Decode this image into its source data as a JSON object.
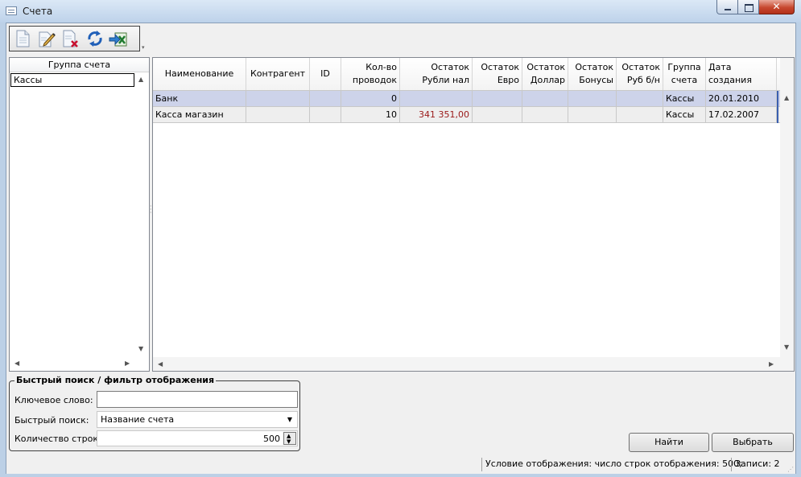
{
  "window": {
    "title": "Счета"
  },
  "toolbar": {
    "buttons": [
      {
        "name": "new-document-icon"
      },
      {
        "name": "edit-pencil-icon"
      },
      {
        "name": "delete-document-icon"
      },
      {
        "name": "refresh-icon"
      },
      {
        "name": "export-excel-icon"
      }
    ]
  },
  "groups": {
    "header": "Группа счета",
    "items": [
      "Кассы"
    ]
  },
  "grid": {
    "columns": [
      "Наименование",
      "Контрагент",
      "ID",
      "Кол-во проводок",
      "Остаток Рубли нал",
      "Остаток Евро",
      "Остаток Доллар",
      "Остаток Бонусы",
      "Остаток Руб б/н",
      "Группа счета",
      "Дата создания"
    ],
    "rows": [
      {
        "name": "Банк",
        "contractor": "",
        "id": "",
        "postings": "0",
        "rub_cash": "",
        "eur": "",
        "usd": "",
        "bonus": "",
        "rub_noncash": "",
        "group": "Кассы",
        "created": "20.01.2010"
      },
      {
        "name": "Касса магазин",
        "contractor": "",
        "id": "",
        "postings": "10",
        "rub_cash": "341 351,00",
        "eur": "",
        "usd": "",
        "bonus": "",
        "rub_noncash": "",
        "group": "Кассы",
        "created": "17.02.2007"
      }
    ]
  },
  "filter": {
    "legend": "Быстрый поиск / фильтр отображения",
    "keyword_label": "Ключевое слово:",
    "keyword_value": "",
    "quick_label": "Быстрый поиск:",
    "quick_value": "Название счета",
    "rows_label": "Количество строк:",
    "rows_value": "500"
  },
  "actions": {
    "find": "Найти",
    "select": "Выбрать"
  },
  "status": {
    "condition": "Условие отображения: число строк отображения: 500;",
    "records": "Записи: 2"
  },
  "colors": {
    "selected_row": "#cdd3ea",
    "negative_balance": "#9a1818"
  }
}
